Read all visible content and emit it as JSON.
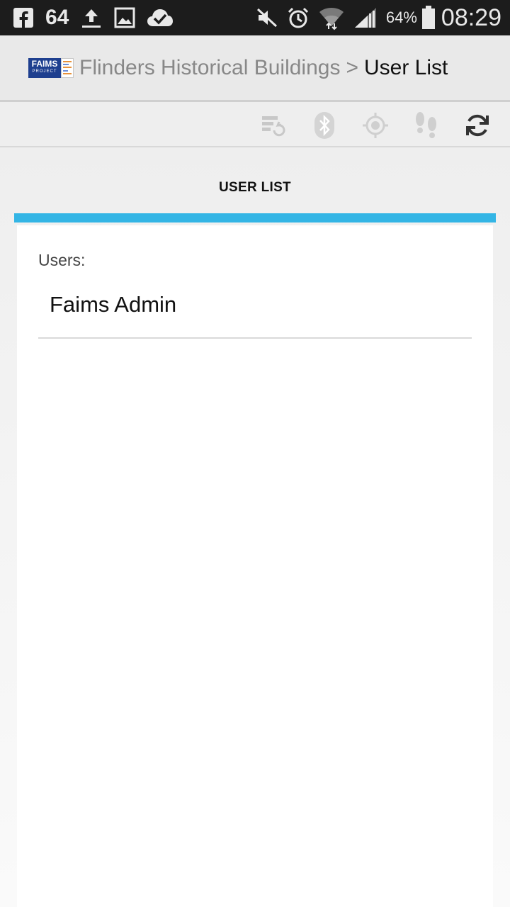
{
  "status_bar": {
    "notification_count": "64",
    "battery_percent": "64%",
    "clock": "08:29",
    "icons": [
      "facebook-icon",
      "upload-icon",
      "gallery-icon",
      "cloud-check-icon",
      "mute-icon",
      "alarm-icon",
      "wifi-icon",
      "signal-icon",
      "battery-icon"
    ]
  },
  "action_bar": {
    "logo_text": "FAIMS",
    "logo_subtext": "PROJECT",
    "module_name": "Flinders Historical Buildings",
    "separator": ">",
    "page_name": "User List"
  },
  "toolbar": {
    "icons": [
      "sync-status-icon",
      "bluetooth-icon",
      "gps-icon",
      "tracking-icon",
      "refresh-icon"
    ]
  },
  "tab": {
    "label": "USER LIST"
  },
  "content": {
    "users_label": "Users:",
    "users": [
      "Faims Admin"
    ]
  },
  "colors": {
    "accent": "#33b5e5",
    "status_bar_bg": "#1c1c1c",
    "logo_blue": "#1e3f8f"
  }
}
